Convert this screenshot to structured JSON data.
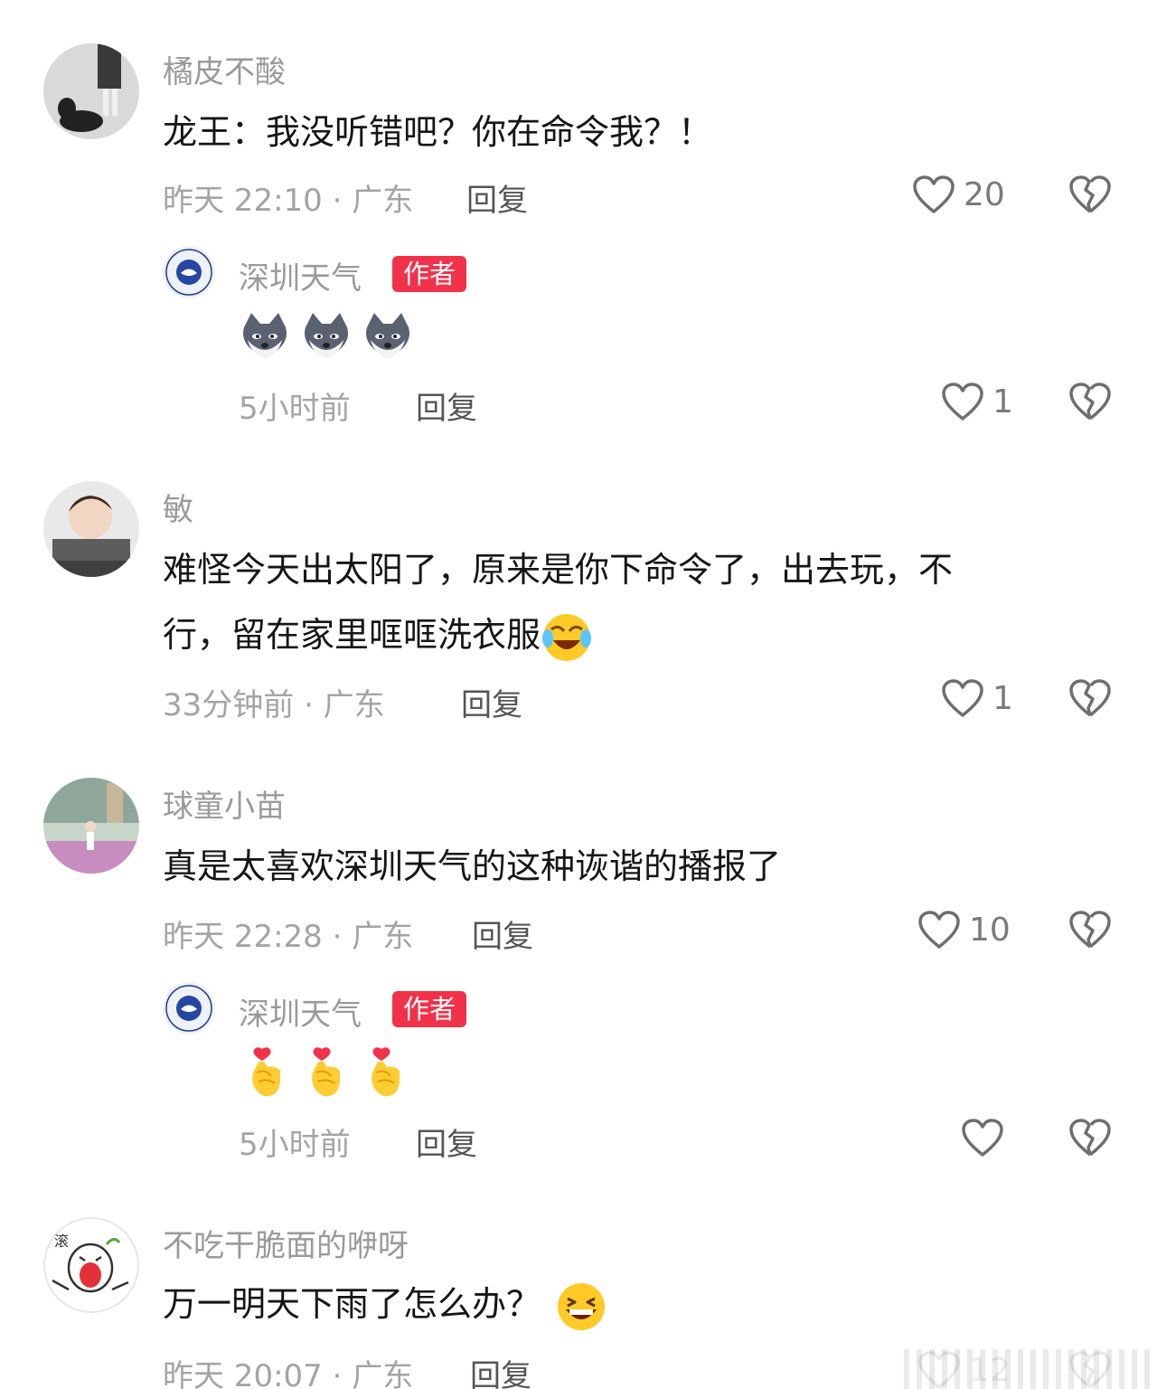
{
  "comments": [
    {
      "user": "橘皮不酸",
      "text": "龙王：我没听错吧？你在命令我？！",
      "meta": "昨天 22:10 · 广东",
      "reply": "回复",
      "likes": "20",
      "replies": [
        {
          "user": "深圳天气",
          "badge": "作者",
          "emojis": [
            "shiba-emoji",
            "shiba-emoji",
            "shiba-emoji"
          ],
          "meta": "5小时前",
          "reply": "回复",
          "likes": "1"
        }
      ]
    },
    {
      "user": "敏",
      "text_line1": "难怪今天出太阳了，原来是你下命令了，出去玩，不",
      "text_line2": "行，留在家里哐哐洗衣服",
      "text_emoji": "laugh-cry-emoji",
      "meta": "33分钟前 · 广东",
      "reply": "回复",
      "likes": "1"
    },
    {
      "user": "球童小苗",
      "text": "真是太喜欢深圳天气的这种诙谐的播报了",
      "meta": "昨天 22:28 · 广东",
      "reply": "回复",
      "likes": "10",
      "replies": [
        {
          "user": "深圳天气",
          "badge": "作者",
          "emojis": [
            "finger-heart-emoji",
            "finger-heart-emoji",
            "finger-heart-emoji"
          ],
          "meta": "5小时前",
          "reply": "回复",
          "likes": ""
        }
      ]
    },
    {
      "user": "不吃干脆面的咿呀",
      "text": "万一明天下雨了怎么办？",
      "text_emoji": "grin-emoji",
      "meta": "昨天 20:07 · 广东",
      "reply": "回复",
      "likes": "12"
    }
  ],
  "colors": {
    "badge": "#f2324a",
    "username": "#9a9a9a",
    "meta": "#a4a4a4",
    "text": "#161616"
  }
}
